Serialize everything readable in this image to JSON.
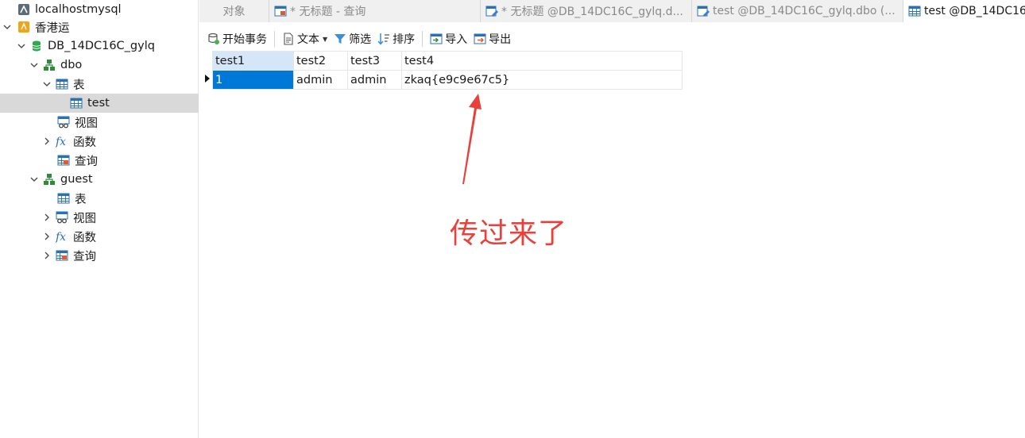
{
  "sidebar": {
    "items": [
      {
        "label": "localhostmysql"
      },
      {
        "label": "香港运"
      },
      {
        "label": "DB_14DC16C_gylq"
      },
      {
        "label": "dbo"
      },
      {
        "label": "表"
      },
      {
        "label": "test"
      },
      {
        "label": "视图"
      },
      {
        "label": "函数"
      },
      {
        "label": "查询"
      },
      {
        "label": "guest"
      },
      {
        "label": "表"
      },
      {
        "label": "视图"
      },
      {
        "label": "函数"
      },
      {
        "label": "查询"
      }
    ]
  },
  "tabs": [
    {
      "label": "对象"
    },
    {
      "label": "* 无标题 - 查询"
    },
    {
      "label": "* 无标题 @DB_14DC16C_gylq.d..."
    },
    {
      "label": "test @DB_14DC16C_gylq.dbo (..."
    },
    {
      "label": "test @DB_14DC16"
    }
  ],
  "toolbar": {
    "begin_transaction": "开始事务",
    "text": "文本",
    "filter": "筛选",
    "sort": "排序",
    "import": "导入",
    "export": "导出"
  },
  "grid": {
    "columns": [
      "test1",
      "test2",
      "test3",
      "test4"
    ],
    "rows": [
      [
        "1",
        "admin",
        "admin",
        "zkaq{e9c9e67c5}"
      ]
    ]
  },
  "annotation": {
    "text": "传过来了",
    "color": "#e8403a"
  },
  "colors": {
    "selection": "#0078d7",
    "header_active": "#d4e6f7",
    "sidebar_selected": "#d9d9d9"
  }
}
